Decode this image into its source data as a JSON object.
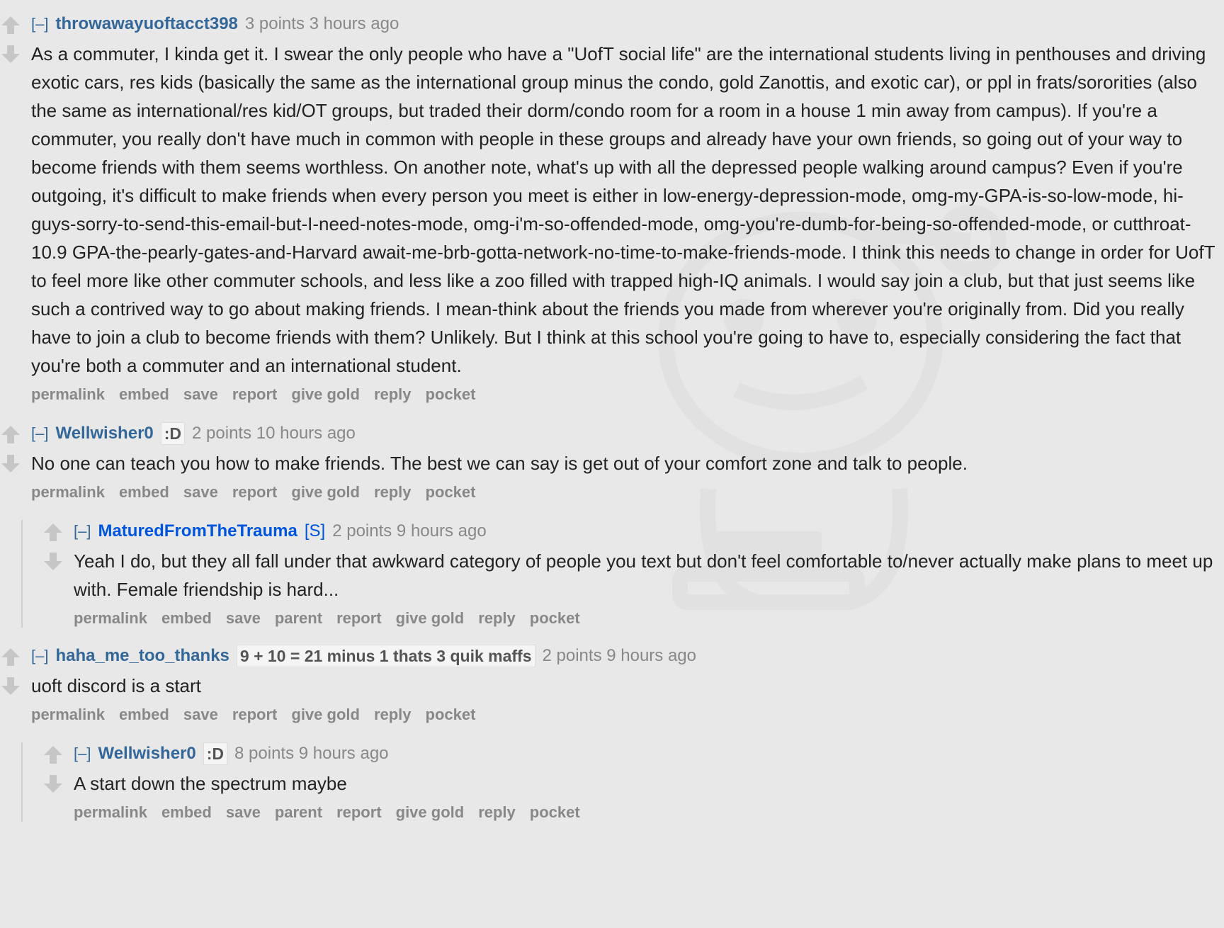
{
  "comments": [
    {
      "expand": "[–]",
      "author": "throwawayuoftacct398",
      "score_time": "3 points 3 hours ago",
      "body": "As a commuter, I kinda get it. I swear the only people who have a \"UofT social life\" are the international students living in penthouses and driving exotic cars, res kids (basically the same as the international group minus the condo, gold Zanottis, and exotic car), or ppl in frats/sororities (also the same as international/res kid/OT groups, but traded their dorm/condo room for a room in a house 1 min away from campus). If you're a commuter, you really don't have much in common with people in these groups and already have your own friends, so going out of your way to become friends with them seems worthless. On another note, what's up with all the depressed people walking around campus? Even if you're outgoing, it's difficult to make friends when every person you meet is either in low-energy-depression-mode, omg-my-GPA-is-so-low-mode, hi-guys-sorry-to-send-this-email-but-I-need-notes-mode, omg-i'm-so-offended-mode, omg-you're-dumb-for-being-so-offended-mode, or cutthroat-10.9 GPA-the-pearly-gates-and-Harvard await-me-brb-gotta-network-no-time-to-make-friends-mode. I think this needs to change in order for UofT to feel more like other commuter schools, and less like a zoo filled with trapped high-IQ animals. I would say join a club, but that just seems like such a contrived way to go about making friends. I mean-think about the friends you made from wherever you're originally from. Did you really have to join a club to become friends with them? Unlikely. But I think at this school you're going to have to, especially considering the fact that you're both a commuter and an international student.",
      "buttons": [
        "permalink",
        "embed",
        "save",
        "report",
        "give gold",
        "reply",
        "pocket"
      ]
    },
    {
      "expand": "[–]",
      "author": "Wellwisher0",
      "flair": ":D",
      "score_time": "2 points 10 hours ago",
      "body": "No one can teach you how to make friends. The best we can say is get out of your comfort zone and talk to people.",
      "buttons": [
        "permalink",
        "embed",
        "save",
        "report",
        "give gold",
        "reply",
        "pocket"
      ]
    },
    {
      "expand": "[–]",
      "author": "MaturedFromTheTrauma",
      "submitter_tag": "[S]",
      "score_time": "2 points 9 hours ago",
      "body": "Yeah I do, but they all fall under that awkward category of people you text but don't feel comfortable to/never actually make plans to meet up with. Female friendship is hard...",
      "buttons": [
        "permalink",
        "embed",
        "save",
        "parent",
        "report",
        "give gold",
        "reply",
        "pocket"
      ]
    },
    {
      "expand": "[–]",
      "author": "haha_me_too_thanks",
      "flair": "9 + 10 = 21 minus 1 thats 3 quik maffs",
      "score_time": "2 points 9 hours ago",
      "body": "uoft discord is a start",
      "buttons": [
        "permalink",
        "embed",
        "save",
        "report",
        "give gold",
        "reply",
        "pocket"
      ]
    },
    {
      "expand": "[–]",
      "author": "Wellwisher0",
      "flair": ":D",
      "score_time": "8 points 9 hours ago",
      "body": "A start down the spectrum maybe",
      "buttons": [
        "permalink",
        "embed",
        "save",
        "parent",
        "report",
        "give gold",
        "reply",
        "pocket"
      ]
    }
  ],
  "icons": {
    "upvote": "upvote-arrow-icon",
    "downvote": "downvote-arrow-icon",
    "watermark": "reddit-alien-watermark"
  },
  "colors": {
    "background": "#e8e8e8",
    "author": "#336699",
    "submitter": "#0055df",
    "meta": "#888888",
    "body": "#222222"
  }
}
